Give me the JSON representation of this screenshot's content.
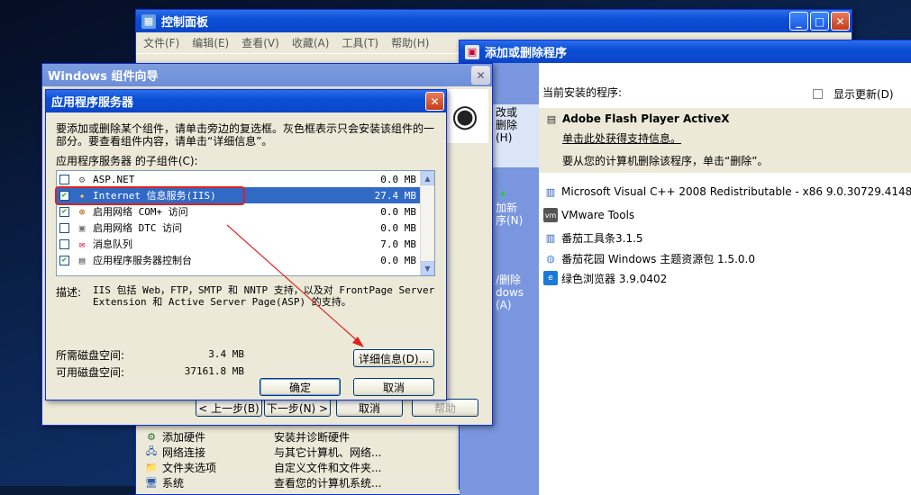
{
  "control_panel": {
    "title": "控制面板",
    "menu": [
      "文件(F)",
      "编辑(E)",
      "查看(V)",
      "收藏(A)",
      "工具(T)",
      "帮助(H)"
    ],
    "items": [
      {
        "name": "添加硬件",
        "desc": "安装并诊断硬件"
      },
      {
        "name": "网络连接",
        "desc": "与其它计算机、网络..."
      },
      {
        "name": "文件夹选项",
        "desc": "自定义文件和文件夹..."
      },
      {
        "name": "系统",
        "desc": "查看您的计算机系统..."
      }
    ]
  },
  "add_remove": {
    "title": "添加或删除程序",
    "sidebar": [
      "更改或删除程序(H)",
      "添加新程序(N)",
      "添加/删除 Windows 组件(A)"
    ],
    "sidebar_visible": [
      "改或",
      "删除",
      "(H)",
      "加新",
      "序(N)",
      "/删除",
      "dows",
      "(A)"
    ],
    "installed_label": "当前安装的程序:",
    "show_updates_label": "显示更新(D)",
    "selected": {
      "name": "Adobe Flash Player ActiveX",
      "support_link": "单击此处获得支持信息。",
      "remove_hint": "要从您的计算机删除该程序，单击“删除”。"
    },
    "programs": [
      "Microsoft Visual C++ 2008 Redistributable - x86 9.0.30729.4148",
      "VMware Tools",
      "番茄工具条3.1.5",
      "番茄花园 Windows 主题资源包 1.5.0.0",
      "绿色浏览器 3.9.0402"
    ]
  },
  "wizard": {
    "title": "Windows 组件向导",
    "back_label": "< 上一步(B)",
    "next_label": "下一步(N) >",
    "cancel_label": "取消",
    "help_label": "帮助"
  },
  "dialog": {
    "title": "应用程序服务器",
    "intro": "要添加或删除某个组件，请单击旁边的复选框。灰色框表示只会安装该组件的一部分。要查看组件内容，请单击“详细信息”。",
    "subcomponents_label": "应用程序服务器 的子组件(C):",
    "components": [
      {
        "name": "ASP.NET",
        "size": "0.0 MB",
        "checked": false,
        "selected": false
      },
      {
        "name": "Internet 信息服务(IIS)",
        "size": "27.4 MB",
        "checked": true,
        "selected": true
      },
      {
        "name": "启用网络 COM+ 访问",
        "size": "0.0 MB",
        "checked": true,
        "selected": false
      },
      {
        "name": "启用网络 DTC 访问",
        "size": "0.0 MB",
        "checked": false,
        "selected": false
      },
      {
        "name": "消息队列",
        "size": "7.0 MB",
        "checked": false,
        "selected": false
      },
      {
        "name": "应用程序服务器控制台",
        "size": "0.0 MB",
        "checked": true,
        "selected": false
      }
    ],
    "description_label": "描述:",
    "description": "IIS 包括 Web，FTP，SMTP 和 NNTP 支持，以及对 FrontPage Server Extension 和 Active Server Page(ASP) 的支持。",
    "required_label": "所需磁盘空间:",
    "required_value": "3.4 MB",
    "available_label": "可用磁盘空间:",
    "available_value": "37161.8 MB",
    "details_label": "详细信息(D)...",
    "ok_label": "确定",
    "cancel_label": "取消"
  },
  "colors": {
    "title_blue": "#0a4fd6",
    "selection": "#316ac5",
    "highlight_box": "#e02020"
  }
}
